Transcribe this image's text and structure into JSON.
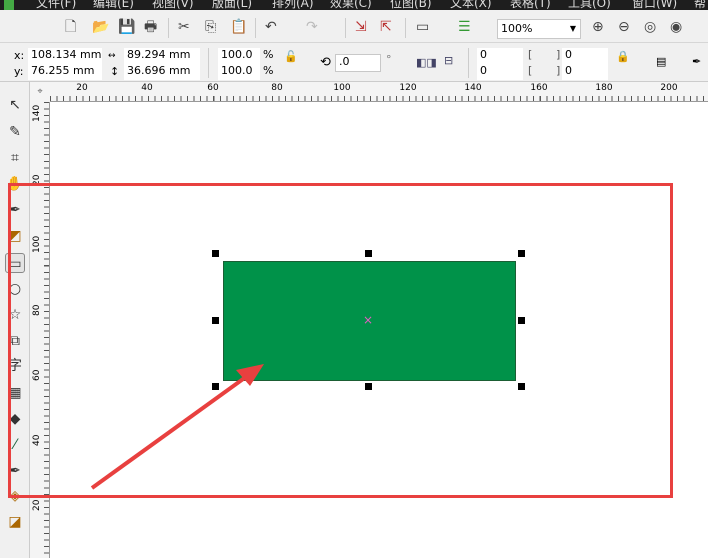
{
  "menu": [
    "文件(F)",
    "编辑(E)",
    "视图(V)",
    "版面(L)",
    "排列(A)",
    "效果(C)",
    "位图(B)",
    "文本(X)",
    "表格(T)",
    "工具(O)",
    "窗口(W)",
    "帮"
  ],
  "toolbar": {
    "zoom": "100%"
  },
  "props": {
    "x_label": "x:",
    "x": "108.134 mm",
    "y_label": "y:",
    "y": "76.255 mm",
    "width": "89.294 mm",
    "height": "36.696 mm",
    "scale_x": "100.0",
    "scale_y": "100.0",
    "pct": "%",
    "angle": ".0",
    "deg": "°",
    "corner1": "0",
    "corner2": "0",
    "corner3": "0",
    "corner4": "0"
  },
  "hruler": [
    "20",
    "40",
    "60",
    "80",
    "100",
    "120",
    "140",
    "160",
    "180",
    "200"
  ],
  "vruler": [
    "140",
    "20",
    "100",
    "80",
    "60",
    "40",
    "20"
  ],
  "shape": {
    "fill": "#009249"
  },
  "tools": [
    "pick",
    "shape",
    "crop",
    "pan",
    "freehand",
    "smart-fill",
    "rectangle",
    "ellipse",
    "polygon",
    "basic-shapes",
    "text",
    "table",
    "extrude",
    "eyedropper",
    "outline",
    "fill",
    "interactive-fill"
  ],
  "text_tool": "字"
}
